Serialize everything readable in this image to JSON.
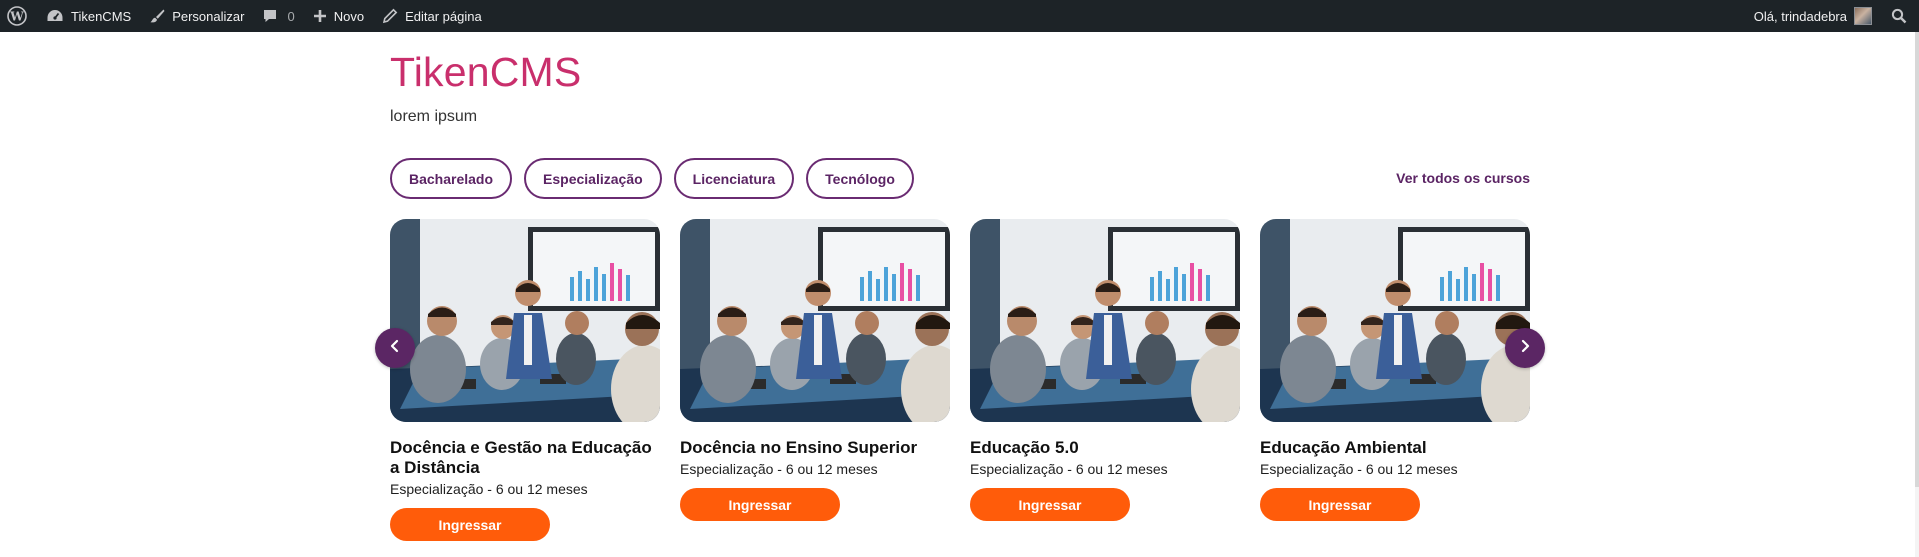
{
  "adminbar": {
    "wp_icon": "wordpress-logo-icon",
    "site_name": "TikenCMS",
    "customize": "Personalizar",
    "comments_count": "0",
    "new": "Novo",
    "edit_page": "Editar página",
    "greeting": "Olá, trindadebra",
    "search_icon": "search-icon"
  },
  "site": {
    "title": "TikenCMS",
    "description": "lorem ipsum"
  },
  "filters": {
    "items": [
      "Bacharelado",
      "Especialização",
      "Licenciatura",
      "Tecnólogo"
    ],
    "see_all": "Ver todos os cursos"
  },
  "courses": [
    {
      "title": "Docência e Gestão na Educação a Distância",
      "meta": "Especialização - 6 ou 12 meses",
      "cta": "Ingressar"
    },
    {
      "title": "Docência no Ensino Superior",
      "meta": "Especialização - 6 ou 12 meses",
      "cta": "Ingressar"
    },
    {
      "title": "Educação 5.0",
      "meta": "Especialização - 6 ou 12 meses",
      "cta": "Ingressar"
    },
    {
      "title": "Educação Ambiental",
      "meta": "Especialização - 6 ou 12 meses",
      "cta": "Ingressar"
    }
  ],
  "carousel": {
    "prev_icon": "chevron-left-icon",
    "next_icon": "chevron-right-icon"
  },
  "colors": {
    "adminbar_bg": "#1d2327",
    "title": "#c92f6c",
    "accent_purple": "#5b2464",
    "cta_orange": "#ff5c0a"
  }
}
